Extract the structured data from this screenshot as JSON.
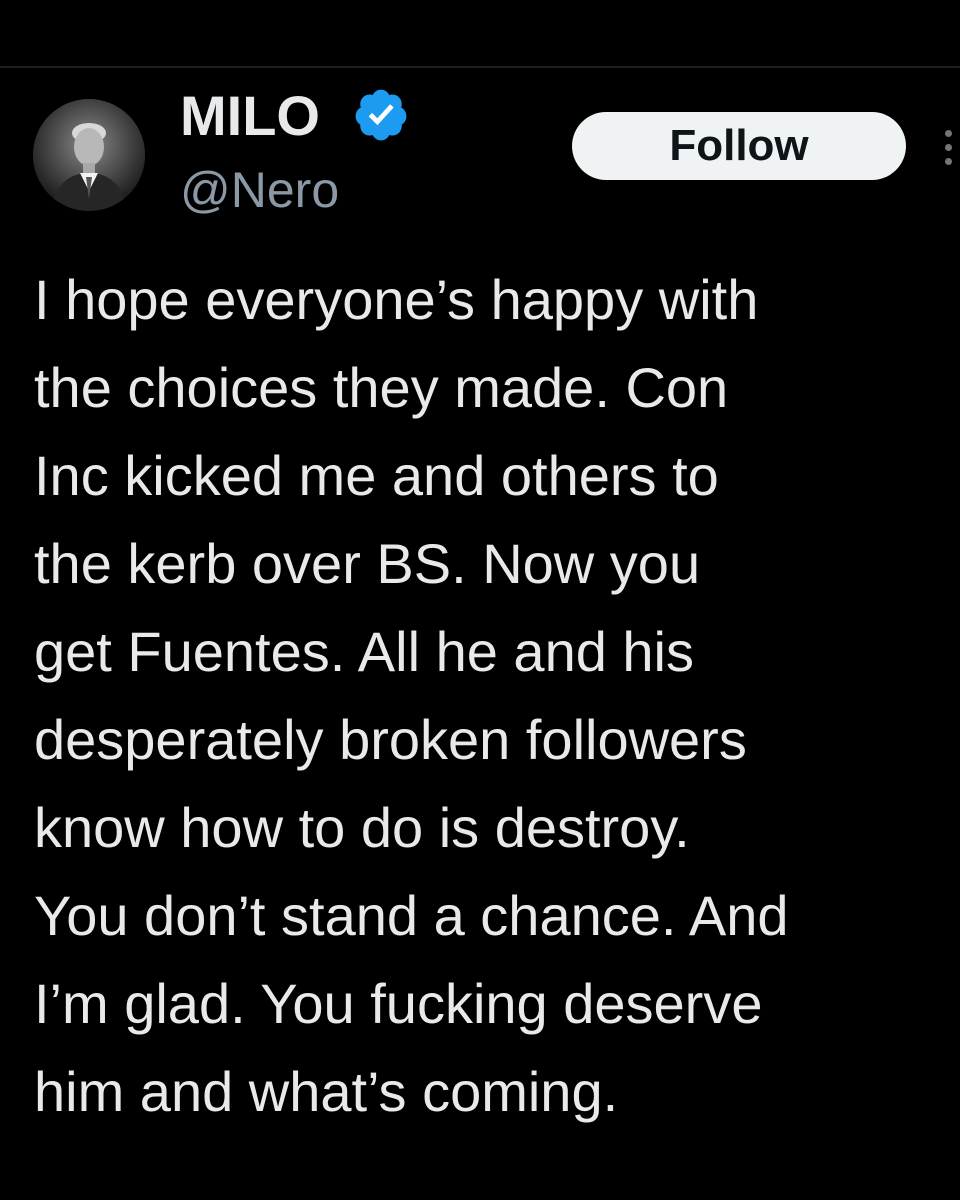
{
  "post": {
    "author": {
      "display_name": "MILO",
      "handle": "@Nero",
      "verified": true,
      "verified_icon": "verified-badge-icon",
      "verified_color": "#1d9bf0"
    },
    "follow_label": "Follow",
    "more_icon": "more-vertical-icon",
    "text_lines": [
      "I hope everyone’s happy with",
      "the choices they made. Con",
      "Inc kicked me and others to",
      "the kerb over BS. Now you",
      "get Fuentes. All he and his",
      "desperately broken followers",
      "know how to do is destroy.",
      "You don’t stand a chance. And",
      "I’m glad. You fucking deserve",
      "him and what’s coming."
    ]
  },
  "colors": {
    "background": "#000000",
    "text": "#e7e9ea",
    "secondary_text": "#8b98a5",
    "button_bg": "#eff3f4"
  }
}
